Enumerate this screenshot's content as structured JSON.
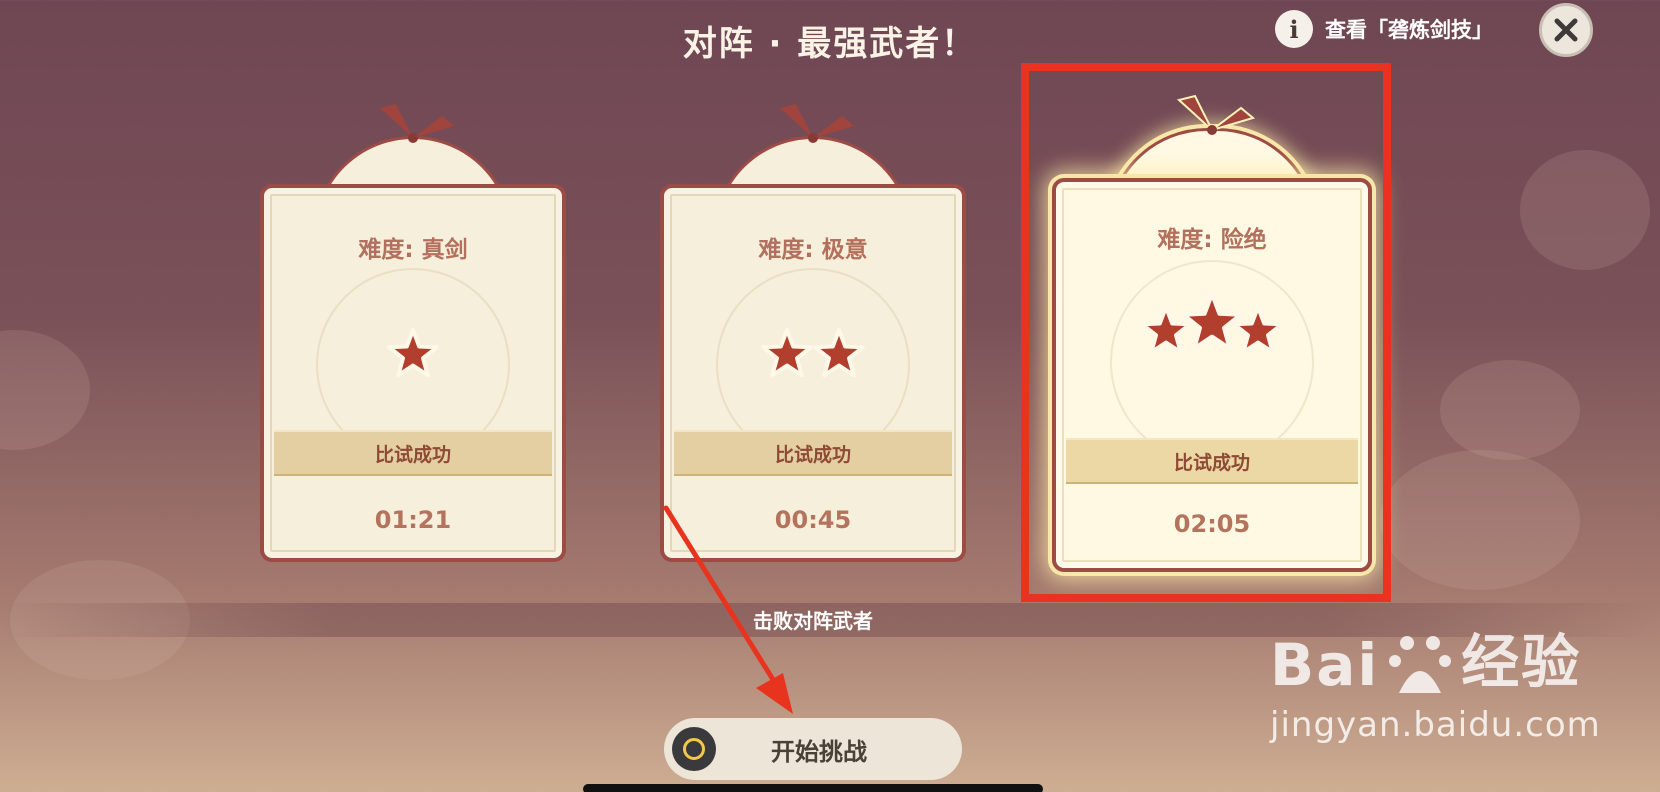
{
  "title": "对阵 · 最强武者！",
  "header": {
    "info_label": "查看「砻炼剑技」"
  },
  "cards": [
    {
      "difficulty": "难度: 真剑",
      "stars": 1,
      "status": "比试成功",
      "time": "01:21",
      "selected": false
    },
    {
      "difficulty": "难度: 极意",
      "stars": 2,
      "status": "比试成功",
      "time": "00:45",
      "selected": false
    },
    {
      "difficulty": "难度: 险绝",
      "stars": 3,
      "status": "比试成功",
      "time": "02:05",
      "selected": true
    }
  ],
  "footer": {
    "hint": "击败对阵武者",
    "start_label": "开始挑战"
  },
  "watermark": {
    "brand_left": "Bai",
    "brand_right": "经验",
    "url": "jingyan.baidu.com"
  },
  "colors": {
    "annotation_red": "#e8341f",
    "card_border": "#9c4b45",
    "star_fill": "#b23f2e"
  },
  "icons": {
    "info": "info-icon",
    "close": "close-icon",
    "start": "controller-button-icon"
  }
}
